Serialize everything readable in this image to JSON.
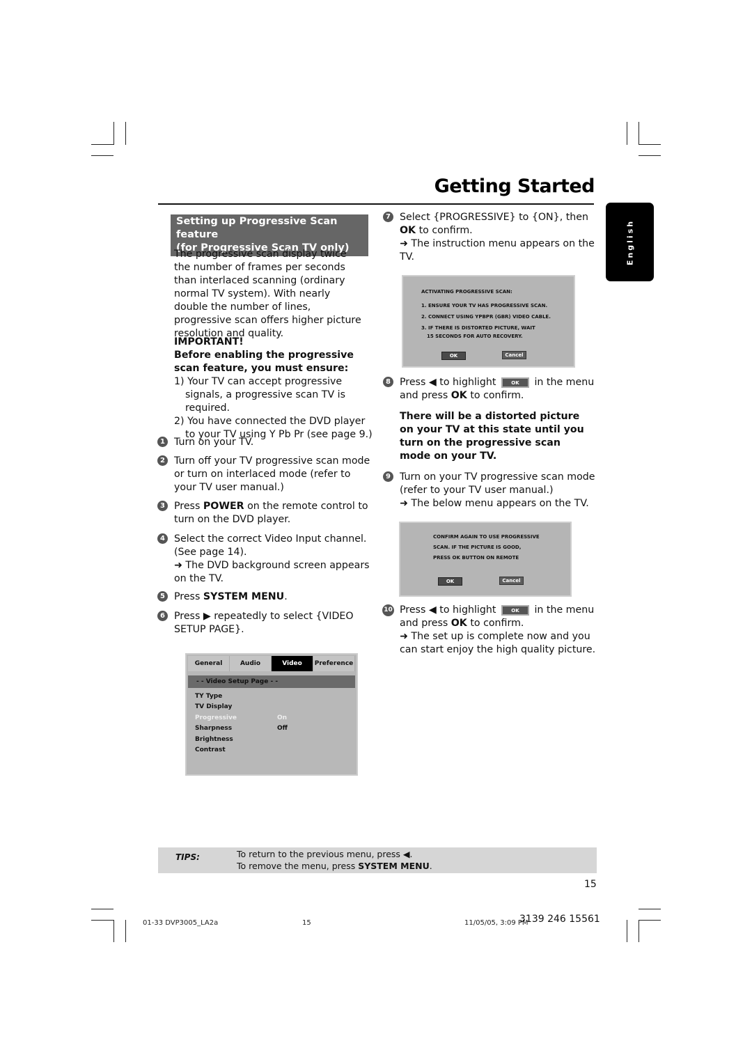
{
  "header": {
    "title": "Getting Started",
    "language_tab": "English"
  },
  "section": {
    "heading_line1": "Setting up Progressive Scan feature",
    "heading_line2": "(for Progressive Scan TV only)",
    "intro": "The progressive scan display twice the number of frames per seconds than interlaced scanning (ordinary normal TV system). With nearly double the number of lines, progressive scan offers higher picture resolution and quality.",
    "important_label": "IMPORTANT!",
    "important_text": "Before enabling the progressive scan feature, you must ensure:",
    "requirements": [
      "1) Your TV can accept progressive signals, a progressive scan TV is required.",
      "2) You have connected the DVD player to your TV using Y Pb Pr (see page 9.)"
    ]
  },
  "steps": [
    {
      "num": "1",
      "text": "Turn on your TV."
    },
    {
      "num": "2",
      "text": "Turn off your TV progressive scan mode or turn on interlaced mode (refer to your TV user manual.)"
    },
    {
      "num": "3",
      "pre": "Press ",
      "bold": "POWER",
      "post": " on the remote control to turn on the DVD player."
    },
    {
      "num": "4",
      "text": "Select the correct Video Input channel. (See page 14).",
      "result": "The DVD background screen appears on the TV."
    },
    {
      "num": "5",
      "pre": "Press ",
      "bold": "SYSTEM MENU",
      "post": "."
    },
    {
      "num": "6",
      "pre": "Press ",
      "glyph": "▶",
      "post": " repeatedly to select {VIDEO SETUP PAGE}."
    },
    {
      "num": "7",
      "pre": "Select {PROGRESSIVE} to {ON}, then ",
      "bold": "OK",
      "post": " to confirm.",
      "result": "The instruction menu appears on the TV."
    },
    {
      "num": "8",
      "pre": "Press ",
      "glyph": "◀",
      "mid": " to highlight ",
      "button": "OK",
      "post": " in the menu and press ",
      "bold": "OK",
      "end": " to confirm."
    },
    {
      "num": "9",
      "text": "Turn on your TV progressive scan mode (refer to your TV user manual.)",
      "result": "The below menu appears on the TV."
    },
    {
      "num": "10",
      "pre": "Press ",
      "glyph": "◀",
      "mid": " to highlight ",
      "button": "OK",
      "post": " in the menu and press ",
      "bold": "OK",
      "end": " to confirm.",
      "result": "The set up is complete now and you can start enjoy the high quality picture."
    }
  ],
  "warning": "There will be a distorted picture on your TV at this state until you turn on the progressive scan mode on your TV.",
  "setup_menu": {
    "tabs": [
      "General",
      "Audio",
      "Video",
      "Preference"
    ],
    "active_tab": "Video",
    "page_title": "- -   Video Setup Page   - -",
    "items": [
      {
        "label": "TY Type",
        "value": ""
      },
      {
        "label": "TV Display",
        "value": ""
      },
      {
        "label": "Progressive",
        "value": "On",
        "highlighted": true
      },
      {
        "label": "Sharpness",
        "value": "Off"
      },
      {
        "label": "Brightness",
        "value": ""
      },
      {
        "label": "Contrast",
        "value": ""
      }
    ]
  },
  "tv_screen_1": {
    "lines": [
      "ACTIVATING PROGRESSIVE SCAN:",
      "1. ENSURE YOUR TV HAS PROGRESSIVE SCAN.",
      "2. CONNECT USING YPBPR (GBR) VIDEO CABLE.",
      "3. IF THERE IS DISTORTED PICTURE, WAIT",
      "   15 SECONDS FOR AUTO RECOVERY."
    ],
    "ok": "OK",
    "cancel": "Cancel"
  },
  "tv_screen_2": {
    "lines": [
      "CONFIRM AGAIN TO USE PROGRESSIVE",
      "SCAN.  IF THE PICTURE IS GOOD,",
      "PRESS OK BUTTON ON REMOTE"
    ],
    "ok": "OK",
    "cancel": "Cancel"
  },
  "tips": {
    "label": "TIPS:",
    "line1_text": "To return to the previous menu, press ",
    "line1_glyph": "◀",
    "line1_end": ".",
    "line2_text": "To remove the menu, press ",
    "line2_bold": "SYSTEM MENU",
    "line2_end": "."
  },
  "page_number": "15",
  "footer": {
    "file": "01-33 DVP3005_LA2a",
    "page": "15",
    "datetime": "11/05/05, 3:09 PM",
    "code": "3139 246 15561"
  }
}
